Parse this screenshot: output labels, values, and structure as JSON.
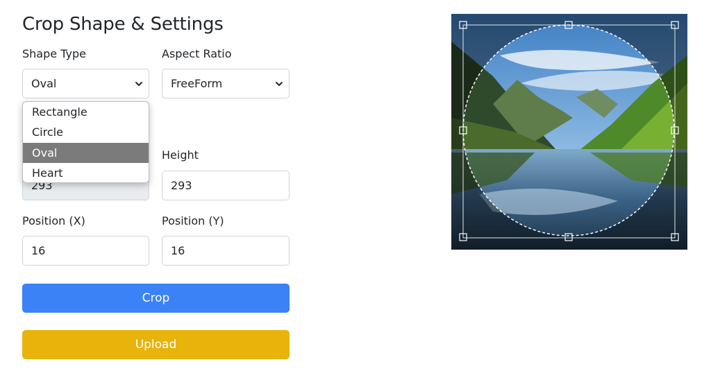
{
  "header": {
    "title": "Crop Shape & Settings"
  },
  "shape_type": {
    "label": "Shape Type",
    "value": "Oval",
    "options": [
      "Rectangle",
      "Circle",
      "Oval",
      "Heart"
    ],
    "selected_index": 2
  },
  "aspect_ratio": {
    "label": "Aspect Ratio",
    "value": "FreeForm"
  },
  "width": {
    "value": "293"
  },
  "height": {
    "label": "Height",
    "value": "293"
  },
  "position_x": {
    "label": "Position (X)",
    "value": "16"
  },
  "position_y": {
    "label": "Position (Y)",
    "value": "16"
  },
  "buttons": {
    "crop": "Crop",
    "upload": "Upload"
  },
  "colors": {
    "crop_button": "#3b82f6",
    "upload_button": "#e8b30a",
    "selected_option": "#7b7b7b"
  },
  "icons": {
    "select_arrow": "chevron-down-icon",
    "crop_handle": "square-handle-icon"
  }
}
